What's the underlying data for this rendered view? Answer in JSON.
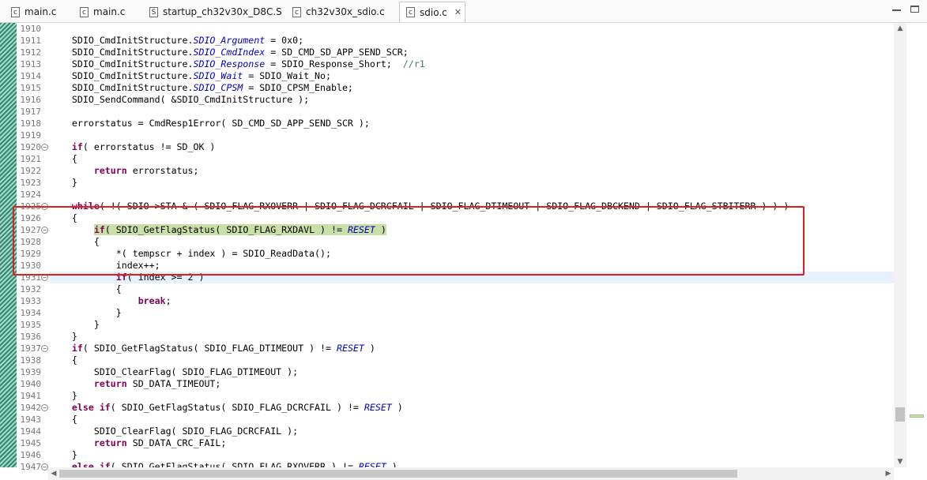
{
  "tabs": [
    {
      "label": "main.c",
      "icon": "c-file-icon",
      "active": false
    },
    {
      "label": "main.c",
      "icon": "c-file-icon",
      "active": false
    },
    {
      "label": "startup_ch32v30x_D8C.S",
      "icon": "s-file-icon",
      "active": false
    },
    {
      "label": "ch32v30x_sdio.c",
      "icon": "c-file-icon",
      "active": false
    },
    {
      "label": "sdio.c",
      "icon": "c-file-icon",
      "active": true
    }
  ],
  "tab_close": "✕",
  "lines": [
    {
      "n": "1910",
      "fold": false,
      "seg": []
    },
    {
      "n": "1911",
      "fold": false,
      "seg": [
        [
          "    SDIO_CmdInitStructure.",
          ""
        ],
        [
          "SDIO_Argument",
          "i"
        ],
        [
          " = 0x0;",
          ""
        ]
      ]
    },
    {
      "n": "1912",
      "fold": false,
      "seg": [
        [
          "    SDIO_CmdInitStructure.",
          ""
        ],
        [
          "SDIO_CmdIndex",
          "i"
        ],
        [
          " = SD_CMD_SD_APP_SEND_SCR;",
          ""
        ]
      ]
    },
    {
      "n": "1913",
      "fold": false,
      "seg": [
        [
          "    SDIO_CmdInitStructure.",
          ""
        ],
        [
          "SDIO_Response",
          "i"
        ],
        [
          " = SDIO_Response_Short;  ",
          ""
        ],
        [
          "//r1",
          "c"
        ]
      ]
    },
    {
      "n": "1914",
      "fold": false,
      "seg": [
        [
          "    SDIO_CmdInitStructure.",
          ""
        ],
        [
          "SDIO_Wait",
          "i"
        ],
        [
          " = SDIO_Wait_No;",
          ""
        ]
      ]
    },
    {
      "n": "1915",
      "fold": false,
      "seg": [
        [
          "    SDIO_CmdInitStructure.",
          ""
        ],
        [
          "SDIO_CPSM",
          "i"
        ],
        [
          " = SDIO_CPSM_Enable;",
          ""
        ]
      ]
    },
    {
      "n": "1916",
      "fold": false,
      "seg": [
        [
          "    SDIO_SendCommand( &SDIO_CmdInitStructure );",
          ""
        ]
      ]
    },
    {
      "n": "1917",
      "fold": false,
      "seg": []
    },
    {
      "n": "1918",
      "fold": false,
      "seg": [
        [
          "    errorstatus = CmdResp1Error( SD_CMD_SD_APP_SEND_SCR );",
          ""
        ]
      ]
    },
    {
      "n": "1919",
      "fold": false,
      "seg": []
    },
    {
      "n": "1920",
      "fold": true,
      "seg": [
        [
          "    ",
          ""
        ],
        [
          "if",
          "k"
        ],
        [
          "( errorstatus != SD_OK )",
          ""
        ]
      ]
    },
    {
      "n": "1921",
      "fold": false,
      "seg": [
        [
          "    {",
          ""
        ]
      ]
    },
    {
      "n": "1922",
      "fold": false,
      "seg": [
        [
          "        ",
          ""
        ],
        [
          "return",
          "k"
        ],
        [
          " errorstatus;",
          ""
        ]
      ]
    },
    {
      "n": "1923",
      "fold": false,
      "seg": [
        [
          "    }",
          ""
        ]
      ]
    },
    {
      "n": "1924",
      "fold": false,
      "seg": []
    },
    {
      "n": "1925",
      "fold": true,
      "seg": [
        [
          "    ",
          ""
        ],
        [
          "while",
          "k"
        ],
        [
          "( !( SDIO->STA & ( SDIO_FLAG_RXOVERR | SDIO_FLAG_DCRCFAIL | SDIO_FLAG_DTIMEOUT | SDIO_FLAG_DBCKEND | SDIO_FLAG_STBITERR ) ) )",
          ""
        ]
      ]
    },
    {
      "n": "1926",
      "fold": false,
      "seg": [
        [
          "    {",
          ""
        ]
      ]
    },
    {
      "n": "1927",
      "fold": true,
      "hl": true,
      "seg": [
        [
          "        ",
          ""
        ],
        [
          "if",
          "k"
        ],
        [
          "( SDIO_GetFlagStatus( SDIO_FLAG_RXDAVL ) != ",
          ""
        ],
        [
          "RESET",
          "i"
        ],
        [
          " )",
          ""
        ]
      ]
    },
    {
      "n": "1928",
      "fold": false,
      "seg": [
        [
          "        {",
          ""
        ]
      ]
    },
    {
      "n": "1929",
      "fold": false,
      "seg": [
        [
          "            *( tempscr + index ) = SDIO_ReadData();",
          ""
        ]
      ]
    },
    {
      "n": "1930",
      "fold": false,
      "seg": [
        [
          "            index++;",
          ""
        ]
      ]
    },
    {
      "n": "1931",
      "fold": true,
      "cur": true,
      "seg": [
        [
          "            ",
          ""
        ],
        [
          "if",
          "k"
        ],
        [
          "( index >= 2 )",
          ""
        ]
      ]
    },
    {
      "n": "1932",
      "fold": false,
      "seg": [
        [
          "            {",
          ""
        ]
      ]
    },
    {
      "n": "1933",
      "fold": false,
      "seg": [
        [
          "                ",
          ""
        ],
        [
          "break",
          "k"
        ],
        [
          ";",
          ""
        ]
      ]
    },
    {
      "n": "1934",
      "fold": false,
      "seg": [
        [
          "            }",
          ""
        ]
      ]
    },
    {
      "n": "1935",
      "fold": false,
      "seg": [
        [
          "        }",
          ""
        ]
      ]
    },
    {
      "n": "1936",
      "fold": false,
      "seg": [
        [
          "    }",
          ""
        ]
      ]
    },
    {
      "n": "1937",
      "fold": true,
      "seg": [
        [
          "    ",
          ""
        ],
        [
          "if",
          "k"
        ],
        [
          "( SDIO_GetFlagStatus( SDIO_FLAG_DTIMEOUT ) != ",
          ""
        ],
        [
          "RESET",
          "i"
        ],
        [
          " )",
          ""
        ]
      ]
    },
    {
      "n": "1938",
      "fold": false,
      "seg": [
        [
          "    {",
          ""
        ]
      ]
    },
    {
      "n": "1939",
      "fold": false,
      "seg": [
        [
          "        SDIO_ClearFlag( SDIO_FLAG_DTIMEOUT );",
          ""
        ]
      ]
    },
    {
      "n": "1940",
      "fold": false,
      "seg": [
        [
          "        ",
          ""
        ],
        [
          "return",
          "k"
        ],
        [
          " SD_DATA_TIMEOUT;",
          ""
        ]
      ]
    },
    {
      "n": "1941",
      "fold": false,
      "seg": [
        [
          "    }",
          ""
        ]
      ]
    },
    {
      "n": "1942",
      "fold": true,
      "seg": [
        [
          "    ",
          ""
        ],
        [
          "else",
          "k"
        ],
        [
          " ",
          ""
        ],
        [
          "if",
          "k"
        ],
        [
          "( SDIO_GetFlagStatus( SDIO_FLAG_DCRCFAIL ) != ",
          ""
        ],
        [
          "RESET",
          "i"
        ],
        [
          " )",
          ""
        ]
      ]
    },
    {
      "n": "1943",
      "fold": false,
      "seg": [
        [
          "    {",
          ""
        ]
      ]
    },
    {
      "n": "1944",
      "fold": false,
      "seg": [
        [
          "        SDIO_ClearFlag( SDIO_FLAG_DCRCFAIL );",
          ""
        ]
      ]
    },
    {
      "n": "1945",
      "fold": false,
      "seg": [
        [
          "        ",
          ""
        ],
        [
          "return",
          "k"
        ],
        [
          " SD_DATA_CRC_FAIL;",
          ""
        ]
      ]
    },
    {
      "n": "1946",
      "fold": false,
      "seg": [
        [
          "    }",
          ""
        ]
      ]
    },
    {
      "n": "1947",
      "fold": true,
      "seg": [
        [
          "    ",
          ""
        ],
        [
          "else",
          "k"
        ],
        [
          " ",
          ""
        ],
        [
          "if",
          "k"
        ],
        [
          "( SDIO_GetFlagStatus( SDIO_FLAG_RXOVERR ) != ",
          ""
        ],
        [
          "RESET",
          "i"
        ],
        [
          " )",
          ""
        ]
      ]
    }
  ],
  "colors": {
    "keyword": "#7f0055",
    "field": "#0000c0",
    "comment": "#3f7f5f",
    "highlight": "#c8e0a8",
    "annotation": "#e02020"
  }
}
